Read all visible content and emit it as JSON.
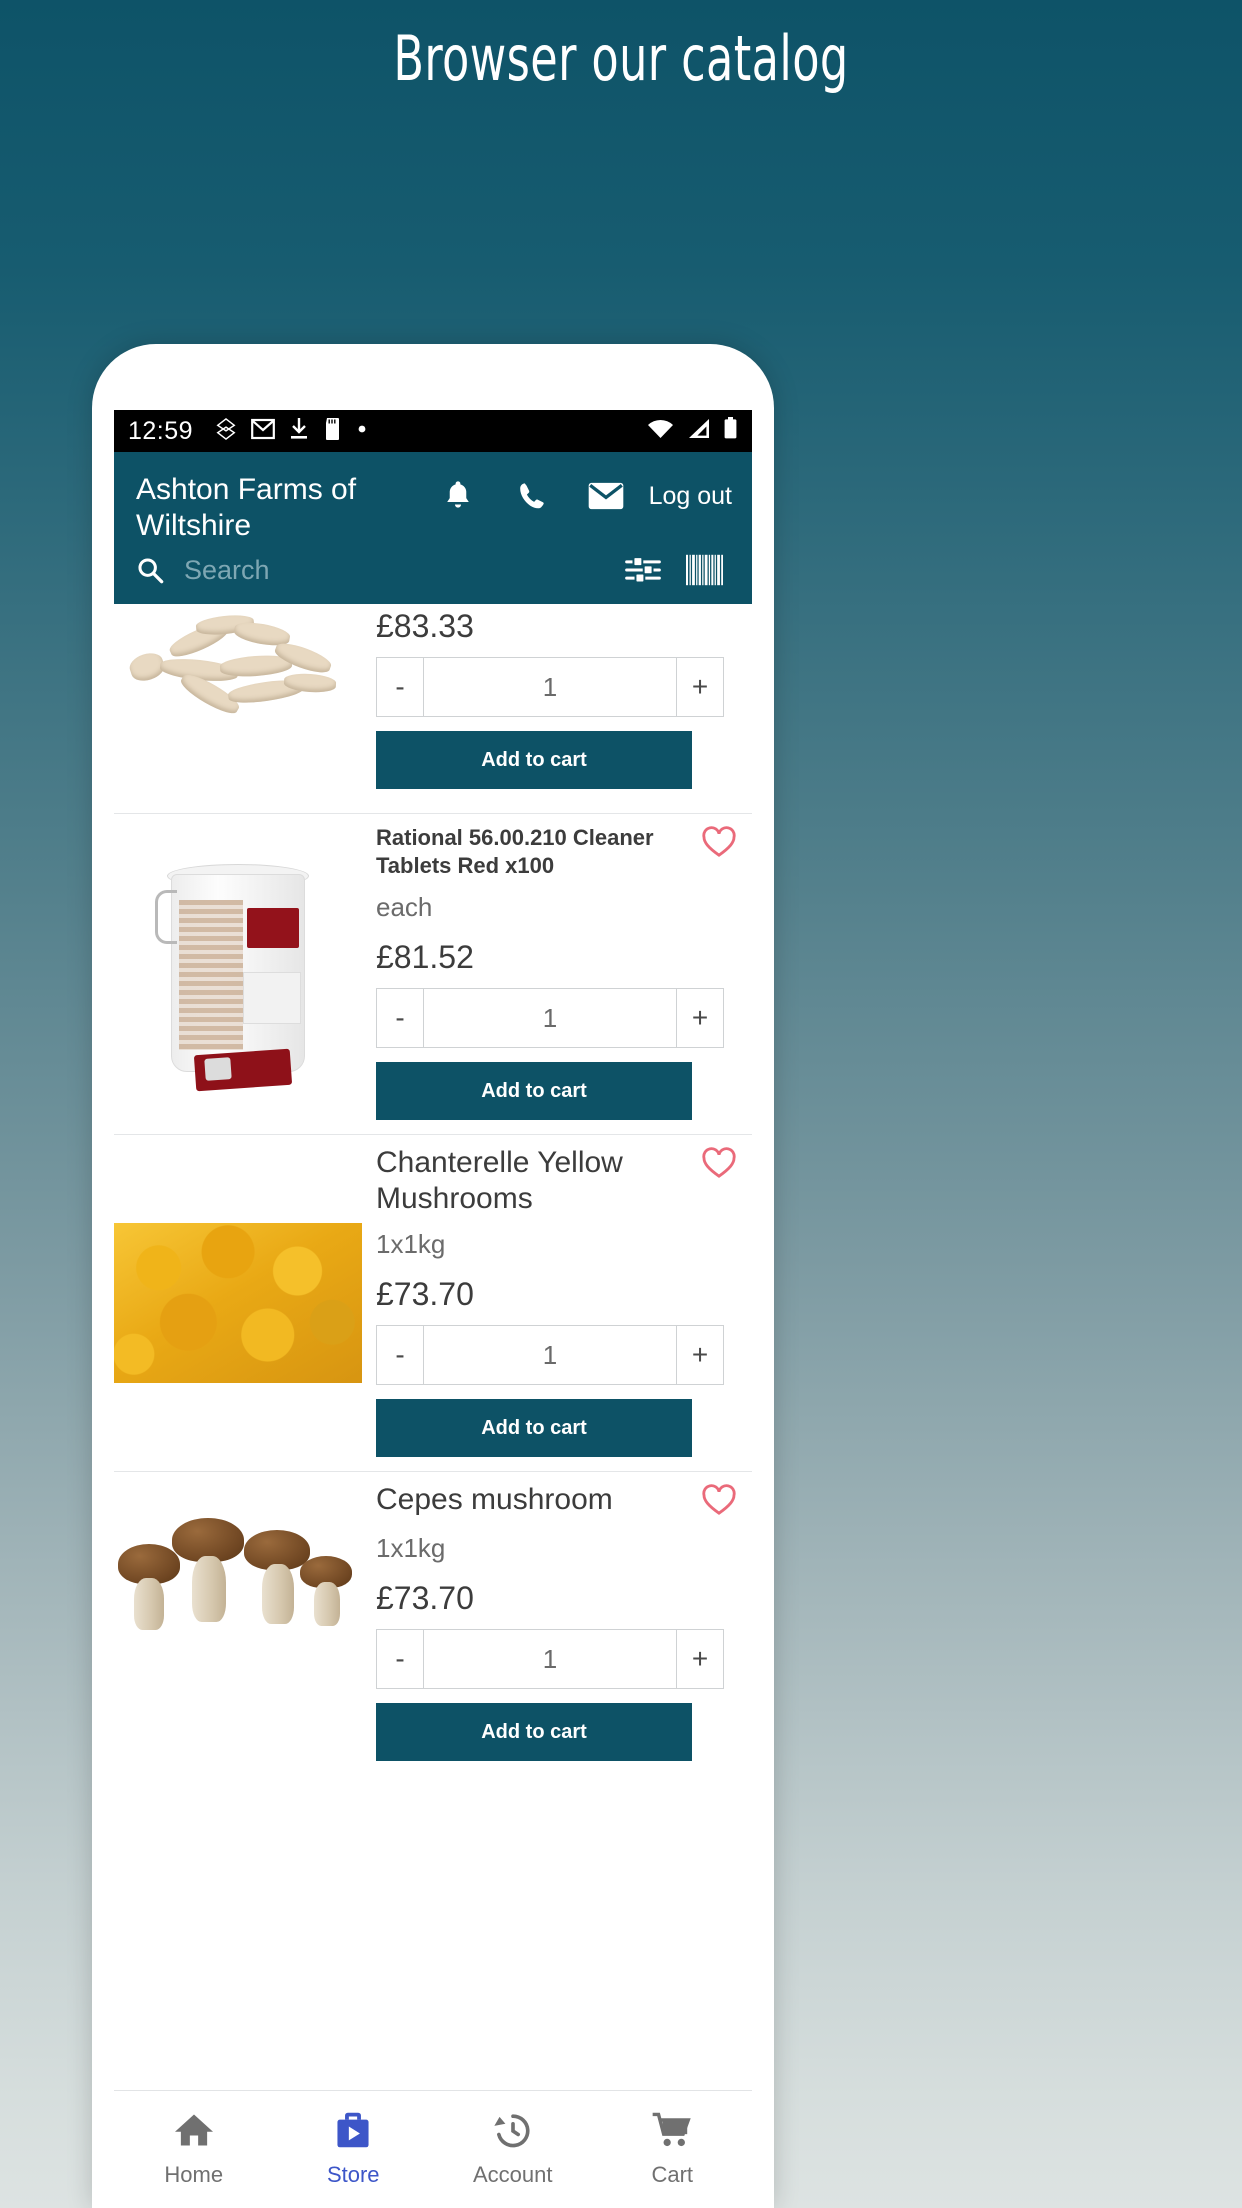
{
  "banner": {
    "title": "Browser our catalog"
  },
  "status_bar": {
    "time": "12:59",
    "left_icons": [
      "sync-icon",
      "gmail-icon",
      "download-icon",
      "sd-card-icon",
      "dot-icon"
    ],
    "right_icons": [
      "wifi-icon",
      "signal-icon",
      "battery-icon"
    ]
  },
  "app_bar": {
    "title": "Ashton Farms of Wiltshire",
    "actions": [
      "notifications-icon",
      "phone-icon",
      "mail-icon"
    ],
    "logout_label": "Log out",
    "background_color": "#0d5266"
  },
  "search": {
    "placeholder": "Search",
    "filter_icon": "filter-sliders-icon",
    "barcode_icon": "barcode-icon"
  },
  "products": [
    {
      "name": "",
      "unit": "",
      "price": "£83.33",
      "quantity": "1",
      "add_label": "Add to cart",
      "favorite": false,
      "image": "crosne-tubers",
      "title_size": "big",
      "partial": true
    },
    {
      "name": "Rational 56.00.210 Cleaner Tablets Red x100",
      "unit": "each",
      "price": "£81.52",
      "quantity": "1",
      "add_label": "Add to cart",
      "favorite": true,
      "image": "cleaner-tablets-bucket",
      "title_size": "small",
      "partial": false
    },
    {
      "name": "Chanterelle Yellow Mushrooms",
      "unit": "1x1kg",
      "price": "£73.70",
      "quantity": "1",
      "add_label": "Add to cart",
      "favorite": true,
      "image": "chanterelle-mushrooms",
      "title_size": "big",
      "partial": false
    },
    {
      "name": "Cepes mushroom",
      "unit": "1x1kg",
      "price": "£73.70",
      "quantity": "1",
      "add_label": "Add to cart",
      "favorite": true,
      "image": "cepes-mushrooms",
      "title_size": "big",
      "partial": false
    }
  ],
  "stepper": {
    "decrement": "-",
    "increment": "+"
  },
  "bottom_nav": {
    "items": [
      {
        "label": "Home",
        "icon": "home-icon",
        "active": false
      },
      {
        "label": "Store",
        "icon": "store-bag-icon",
        "active": true
      },
      {
        "label": "Account",
        "icon": "history-icon",
        "active": false
      },
      {
        "label": "Cart",
        "icon": "cart-icon",
        "active": false
      }
    ],
    "active_color": "#3d56c8",
    "inactive_color": "#707070"
  },
  "colors": {
    "brand_teal": "#0d5266",
    "heart_pink": "#ea6a7a",
    "banner_bg_top": "#0e5368"
  }
}
